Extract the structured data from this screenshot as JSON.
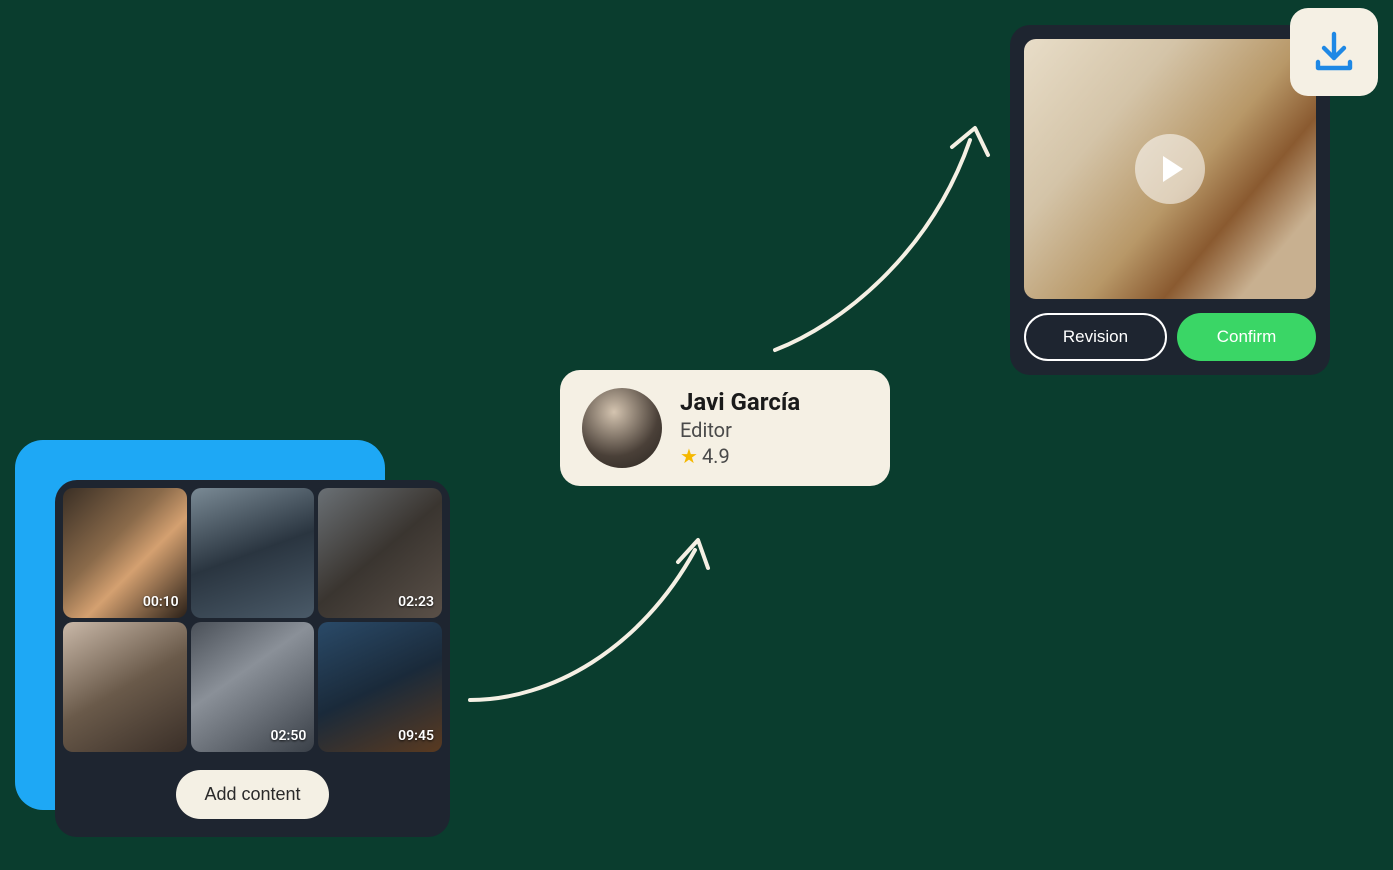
{
  "content_grid": {
    "thumbnails": [
      {
        "timestamp": "00:10"
      },
      {
        "timestamp": ""
      },
      {
        "timestamp": "02:23"
      },
      {
        "timestamp": ""
      },
      {
        "timestamp": "02:50"
      },
      {
        "timestamp": "09:45"
      }
    ],
    "add_button_label": "Add content"
  },
  "editor": {
    "name": "Javi García",
    "role": "Editor",
    "rating": "4.9"
  },
  "preview": {
    "revision_label": "Revision",
    "confirm_label": "Confirm"
  }
}
